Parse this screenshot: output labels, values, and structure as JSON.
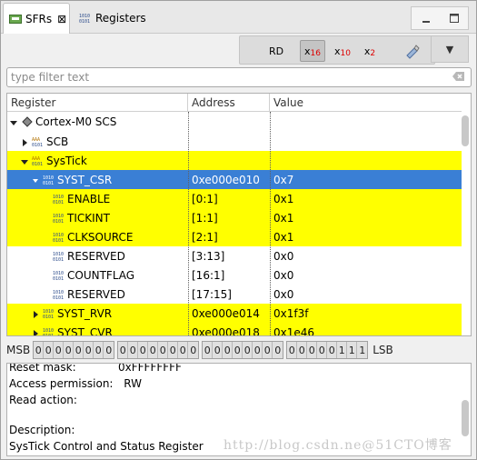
{
  "tabs": [
    {
      "label": "SFRs",
      "icon": "sfr-icon",
      "close": "⊠"
    },
    {
      "label": "Registers",
      "icon": "binary-icon"
    }
  ],
  "toolbar": {
    "rd": "RD",
    "hex": {
      "x": "x",
      "sub": "16"
    },
    "dec": {
      "x": "x",
      "sub": "10"
    },
    "bin": {
      "x": "x",
      "sub": "2"
    },
    "menu": "▼"
  },
  "filter": {
    "placeholder": "type filter text"
  },
  "table": {
    "headers": [
      "Register",
      "Address",
      "Value"
    ],
    "rows": [
      {
        "name": "Cortex-M0 SCS",
        "address": "",
        "value": ""
      },
      {
        "name": "SCB",
        "address": "",
        "value": ""
      },
      {
        "name": "SysTick",
        "address": "",
        "value": ""
      },
      {
        "name": "SYST_CSR",
        "address": "0xe000e010",
        "value": "0x7"
      },
      {
        "name": "ENABLE",
        "address": "[0:1]",
        "value": "0x1"
      },
      {
        "name": "TICKINT",
        "address": "[1:1]",
        "value": "0x1"
      },
      {
        "name": "CLKSOURCE",
        "address": "[2:1]",
        "value": "0x1"
      },
      {
        "name": "RESERVED",
        "address": "[3:13]",
        "value": "0x0"
      },
      {
        "name": "COUNTFLAG",
        "address": "[16:1]",
        "value": "0x0"
      },
      {
        "name": "RESERVED",
        "address": "[17:15]",
        "value": "0x0"
      },
      {
        "name": "SYST_RVR",
        "address": "0xe000e014",
        "value": "0x1f3f"
      },
      {
        "name": "SYST_CVR",
        "address": "0xe000e018",
        "value": "0x1e46"
      }
    ]
  },
  "bits": {
    "msb": "MSB",
    "lsb": "LSB",
    "groups": [
      "00000000",
      "00000000",
      "00000000",
      "00000111"
    ]
  },
  "description": {
    "reset_mask_label": "Reset mask:",
    "reset_mask": "0xFFFFFFFF",
    "access_label": "Access permission:",
    "access": "RW",
    "read_action_label": "Read action:",
    "desc_label": "Description:",
    "desc": "SysTick Control and Status Register"
  },
  "watermark": "http://blog.csdn.ne@51CTO博客",
  "colors": {
    "highlight": "#ffff00",
    "selection": "#3a7fd5"
  }
}
